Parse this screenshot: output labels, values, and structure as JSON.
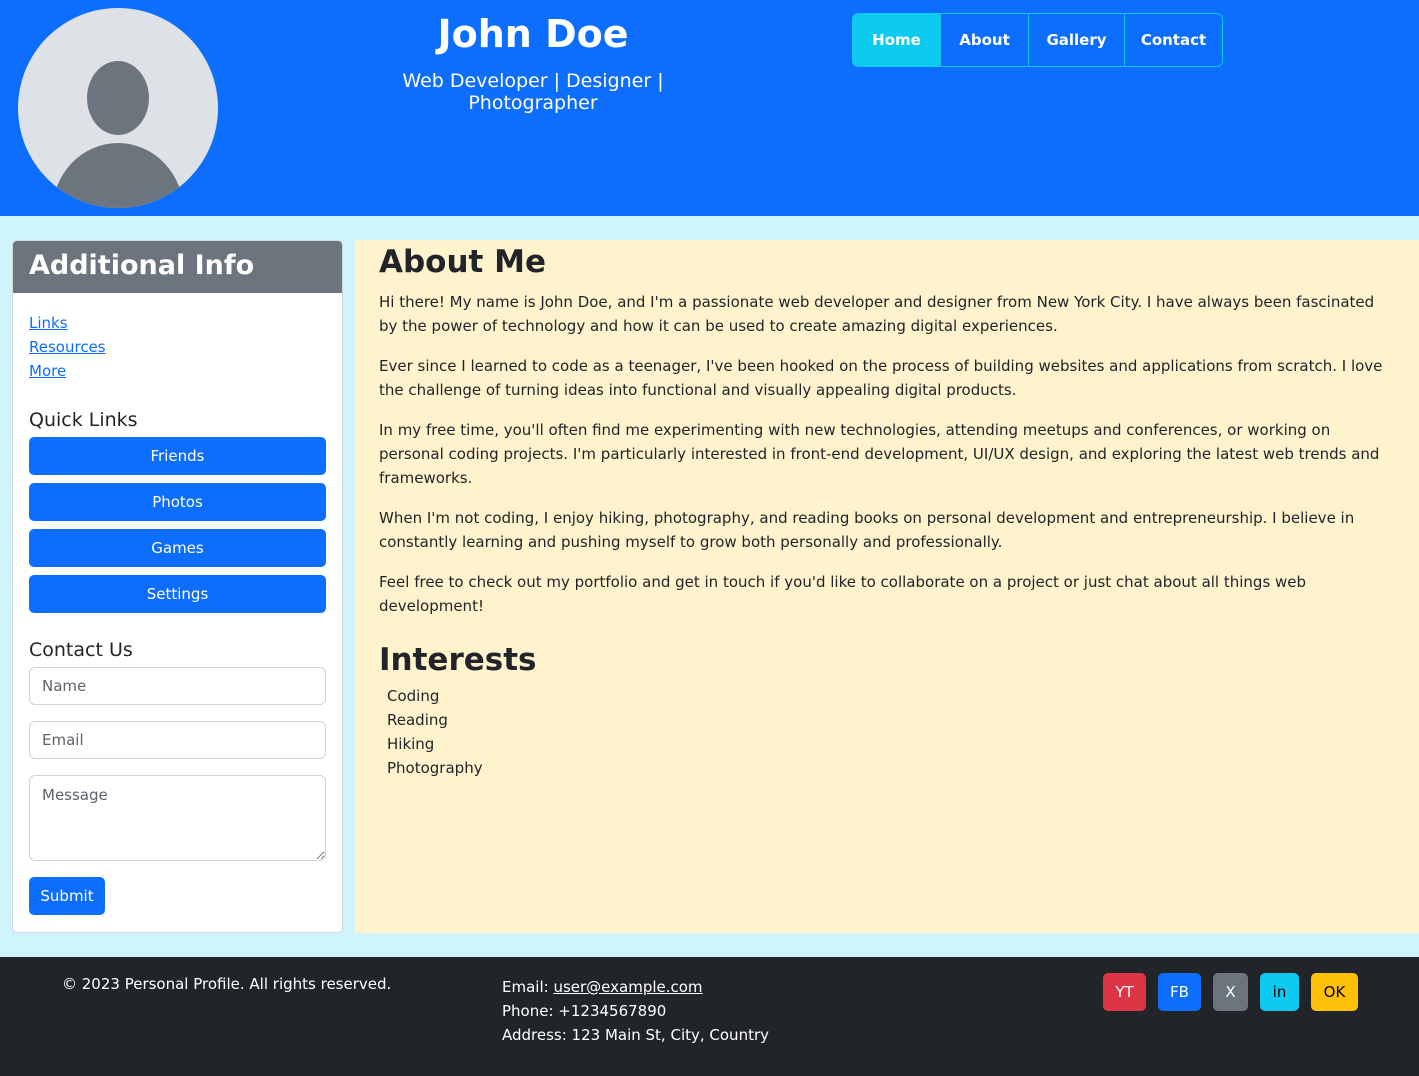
{
  "header": {
    "name": "John Doe",
    "tagline": "Web Developer | Designer | Photographer",
    "nav": [
      {
        "label": "Home"
      },
      {
        "label": "About"
      },
      {
        "label": "Gallery"
      },
      {
        "label": "Contact"
      }
    ]
  },
  "sidebar": {
    "title": "Additional Info",
    "links": [
      "Links",
      "Resources",
      "More"
    ],
    "quick_links_title": "Quick Links",
    "quick_links": [
      "Friends",
      "Photos",
      "Games",
      "Settings"
    ],
    "contact_title": "Contact Us",
    "name_placeholder": "Name",
    "email_placeholder": "Email",
    "message_placeholder": "Message",
    "submit_label": "Submit"
  },
  "main": {
    "about_title": "About Me",
    "paragraphs": [
      "Hi there! My name is John Doe, and I'm a passionate web developer and designer from New York City. I have always been fascinated by the power of technology and how it can be used to create amazing digital experiences.",
      "Ever since I learned to code as a teenager, I've been hooked on the process of building websites and applications from scratch. I love the challenge of turning ideas into functional and visually appealing digital products.",
      "In my free time, you'll often find me experimenting with new technologies, attending meetups and conferences, or working on personal coding projects. I'm particularly interested in front-end development, UI/UX design, and exploring the latest web trends and frameworks.",
      "When I'm not coding, I enjoy hiking, photography, and reading books on personal development and entrepreneurship. I believe in constantly learning and pushing myself to grow both personally and professionally.",
      "Feel free to check out my portfolio and get in touch if you'd like to collaborate on a project or just chat about all things web development!"
    ],
    "interests_title": "Interests",
    "interests": [
      "Coding",
      "Reading",
      "Hiking",
      "Photography"
    ]
  },
  "footer": {
    "copyright": "© 2023 Personal Profile. All rights reserved.",
    "email_label": "Email: ",
    "email": "user@example.com",
    "phone": "Phone: +1234567890",
    "address": "Address: 123 Main St, City, Country",
    "social": [
      "YT",
      "FB",
      "X",
      "in",
      "OK"
    ]
  },
  "colors": {
    "primary": "#0d6efd",
    "info": "#0dcaf0",
    "secondary": "#6c757d",
    "danger": "#dc3545",
    "warning": "#ffc107",
    "page_bg": "#cff4fc",
    "main_bg": "#fff3cd",
    "footer_bg": "#212529"
  }
}
